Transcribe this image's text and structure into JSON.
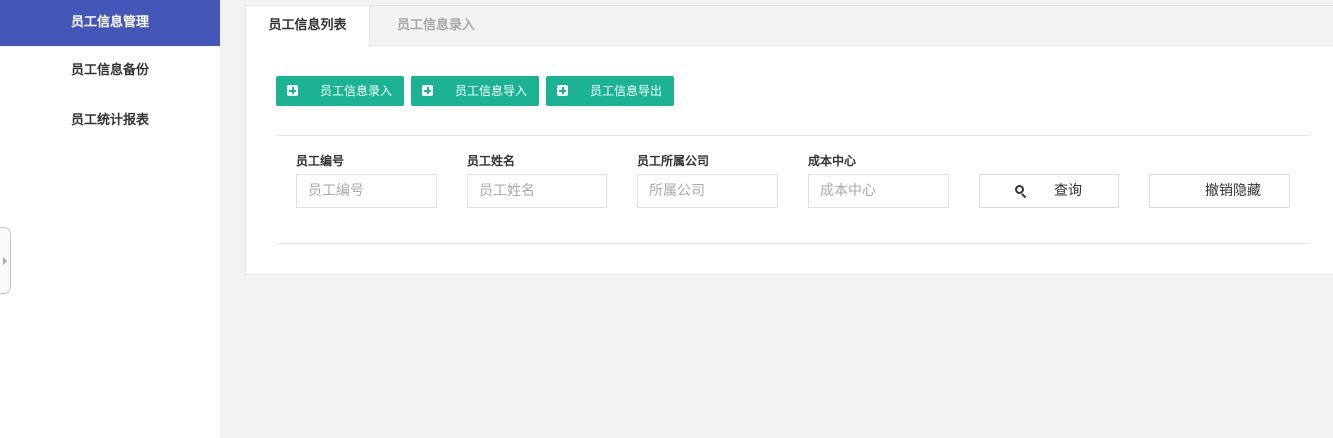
{
  "sidebar": {
    "items": [
      {
        "label": "员工信息管理"
      },
      {
        "label": "员工信息备份"
      },
      {
        "label": "员工统计报表"
      }
    ]
  },
  "tabs": [
    {
      "label": "员工信息列表"
    },
    {
      "label": "员工信息录入"
    }
  ],
  "actions": {
    "entry": "员工信息录入",
    "import": "员工信息导入",
    "export": "员工信息导出"
  },
  "filters": {
    "employee_no": {
      "label": "员工编号",
      "placeholder": "员工编号",
      "value": ""
    },
    "employee_name": {
      "label": "员工姓名",
      "placeholder": "员工姓名",
      "value": ""
    },
    "company": {
      "label": "员工所属公司",
      "placeholder": "所属公司",
      "value": ""
    },
    "cost_center": {
      "label": "成本中心",
      "placeholder": "成本中心",
      "value": ""
    }
  },
  "buttons": {
    "query": "查询",
    "unhide": "撤销隐藏"
  },
  "colors": {
    "sidebar_active": "#4456b7",
    "action_green": "#1bb394"
  }
}
